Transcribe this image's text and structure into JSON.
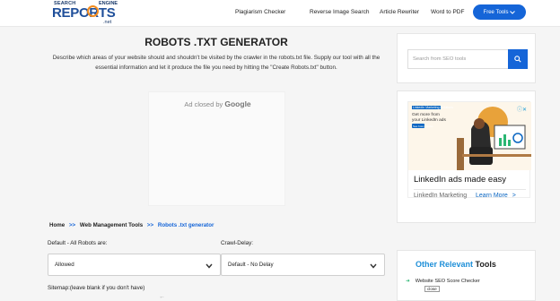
{
  "header": {
    "logo": {
      "line1a": "SEARCH",
      "line1b": "ENGINE",
      "line2": "REPORTS",
      "line3": ".net"
    },
    "nav": [
      "Plagiarism Checker",
      "Reverse Image Search",
      "Article Rewriter",
      "Word to PDF"
    ],
    "free_tools": "Free Tools",
    "free_tools_icon": "chevron-down-icon",
    "accent": "#1565d8"
  },
  "main": {
    "title": "ROBOTS .TXT GENERATOR",
    "description": "Describe which areas of your website should and shouldn't be visited by the crawler in the robots.txt file. Supply our tool with all the essential information and let it produce the file you need by hitting the \"Create Robots.txt\" button.",
    "ad": {
      "prefix": "Ad closed by",
      "brand": "Google"
    },
    "breadcrumb": {
      "home": "Home",
      "sep": ">>",
      "section": "Web Management Tools",
      "current": "Robots .txt generator"
    },
    "form": {
      "default_label": "Default - All Robots are:",
      "default_value": "Allowed",
      "crawl_label": "Crawl-Delay:",
      "crawl_value": "Default - No Delay",
      "sitemap_label": "Sitemap:(leave blank if you don't have)"
    }
  },
  "sidebar": {
    "search_placeholder": "Search from SEO tools",
    "search_icon": "search-icon",
    "ad": {
      "brand": "LinkedIn Marketing Solutions",
      "headline_small": "Get more from your LinkedIn ads",
      "cta_small": "See how it works",
      "headline": "LinkedIn ads made easy",
      "sponsor": "LinkedIn Marketing",
      "cta": "Learn More",
      "cta_arrow": ">"
    },
    "other": {
      "title_a": "Other Relevant",
      "title_b": "Tools",
      "items": [
        "Website SEO Score Checker"
      ],
      "tooltip": "close"
    }
  }
}
